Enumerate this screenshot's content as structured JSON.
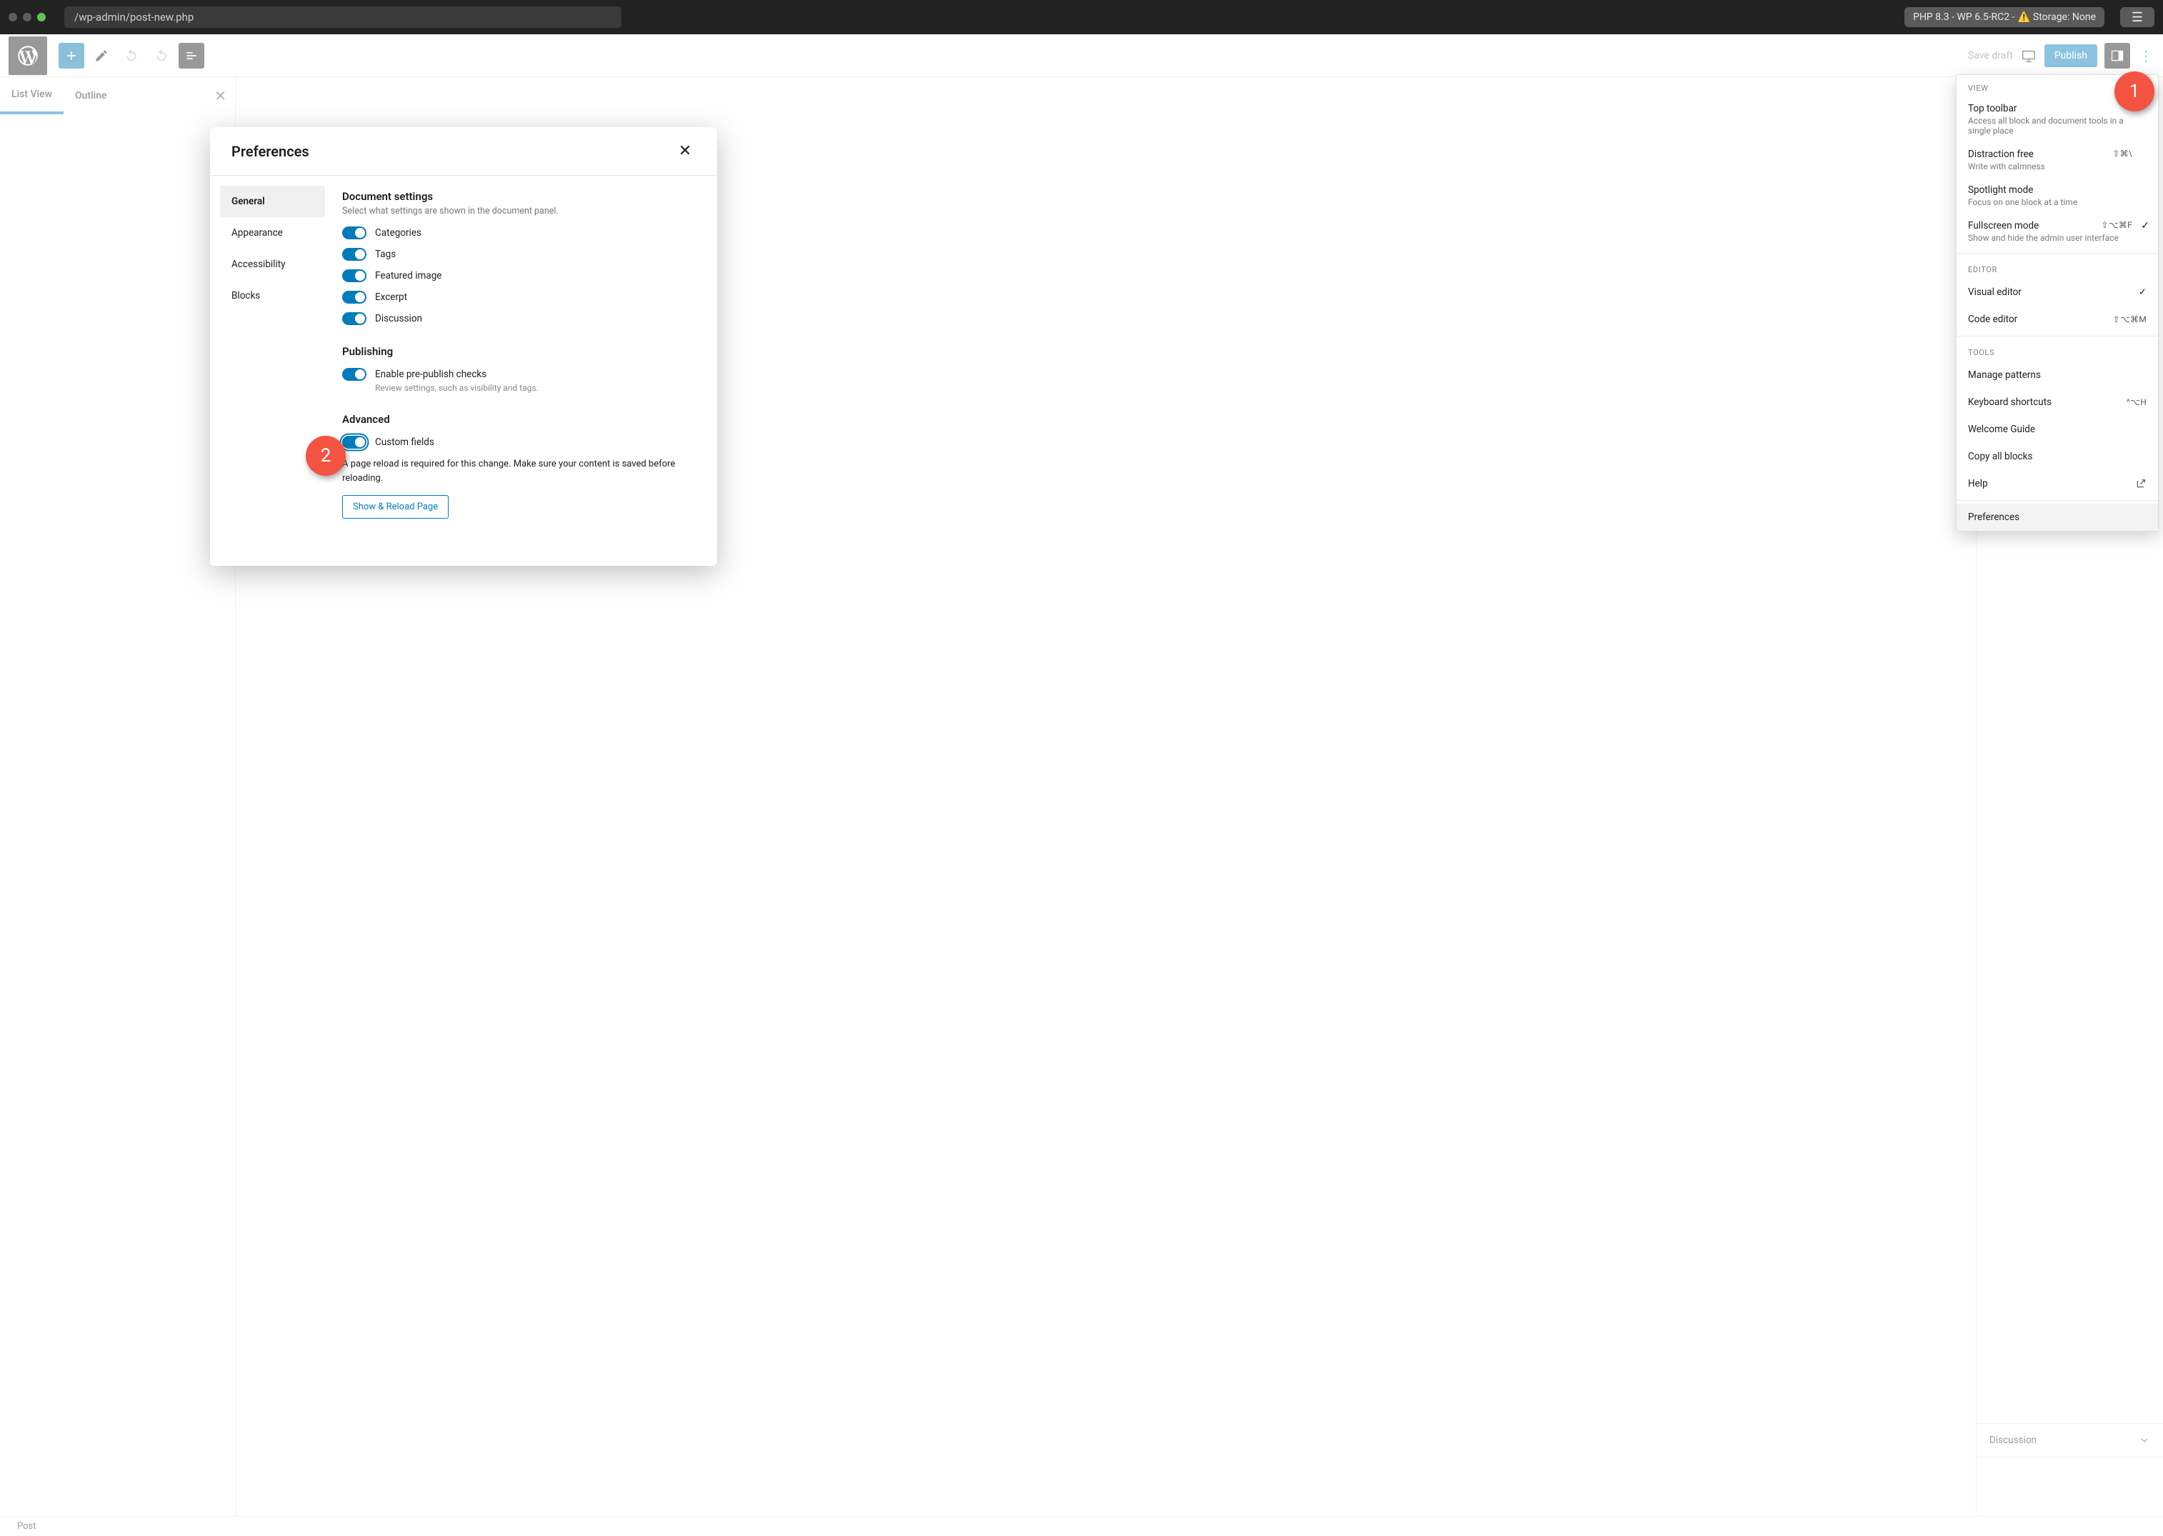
{
  "titlebar": {
    "url": "/wp-admin/post-new.php",
    "env_badge_prefix": "PHP 8.3 - WP 6.5-RC2 - ",
    "env_badge_suffix": " Storage: None"
  },
  "toolbar": {
    "save_draft": "Save draft",
    "publish": "Publish"
  },
  "leftpanel": {
    "tab_list_view": "List View",
    "tab_outline": "Outline"
  },
  "inspector": {
    "discussion": "Discussion"
  },
  "statusbar": {
    "text": "Post"
  },
  "menu": {
    "section_view": "View",
    "top_toolbar": {
      "title": "Top toolbar",
      "sub": "Access all block and document tools in a single place"
    },
    "distraction_free": {
      "title": "Distraction free",
      "sub": "Write with calmness",
      "shortcut": "⇧⌘\\"
    },
    "spotlight": {
      "title": "Spotlight mode",
      "sub": "Focus on one block at a time"
    },
    "fullscreen": {
      "title": "Fullscreen mode",
      "sub": "Show and hide the admin user interface",
      "shortcut": "⇧⌥⌘F"
    },
    "section_editor": "Editor",
    "visual_editor": "Visual editor",
    "code_editor": "Code editor",
    "code_editor_shortcut": "⇧⌥⌘M",
    "section_tools": "Tools",
    "manage_patterns": "Manage patterns",
    "keyboard_shortcuts": "Keyboard shortcuts",
    "keyboard_shortcuts_shortcut": "^⌥H",
    "welcome_guide": "Welcome Guide",
    "copy_all": "Copy all blocks",
    "help": "Help",
    "preferences": "Preferences"
  },
  "modal": {
    "title": "Preferences",
    "nav": {
      "general": "General",
      "appearance": "Appearance",
      "accessibility": "Accessibility",
      "blocks": "Blocks"
    },
    "doc_settings": {
      "heading": "Document settings",
      "desc": "Select what settings are shown in the document panel.",
      "categories": "Categories",
      "tags": "Tags",
      "featured_image": "Featured image",
      "excerpt": "Excerpt",
      "discussion": "Discussion"
    },
    "publishing": {
      "heading": "Publishing",
      "enable_label": "Enable pre-publish checks",
      "enable_hint": "Review settings, such as visibility and tags."
    },
    "advanced": {
      "heading": "Advanced",
      "custom_fields": "Custom fields",
      "note": "A page reload is required for this change. Make sure your content is saved before reloading.",
      "reload_btn": "Show & Reload Page"
    }
  },
  "callouts": {
    "one": "1",
    "two": "2"
  }
}
